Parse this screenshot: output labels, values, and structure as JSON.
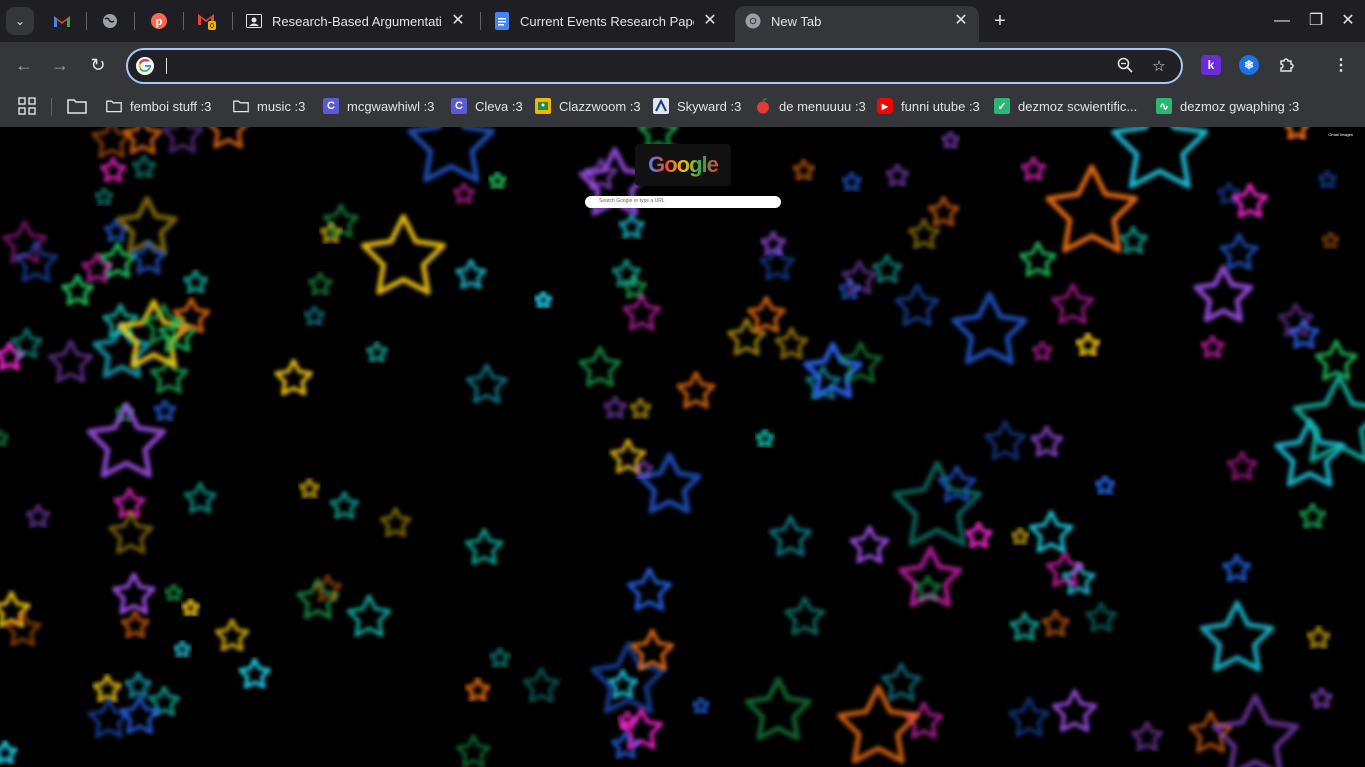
{
  "tabs": {
    "pinned": [
      {
        "name": "gmail",
        "color": "#ea4335"
      },
      {
        "name": "globe",
        "color": "#9aa0a6"
      },
      {
        "name": "p-app",
        "color": "#f96854"
      },
      {
        "name": "gmail-notify",
        "color": "#ea4335",
        "badge": "0"
      }
    ],
    "items": [
      {
        "title": "Research-Based Argumentative",
        "icon": "classroom-icon"
      },
      {
        "title": "Current Events Research Paper",
        "icon": "docs-icon"
      },
      {
        "title": "New Tab",
        "icon": "chrome-icon",
        "active": true
      }
    ]
  },
  "omnibox": {
    "value": "",
    "placeholder": ""
  },
  "bookmarks": [
    {
      "label": "femboi stuff :3",
      "icon": "folder-icon"
    },
    {
      "label": "music :3",
      "icon": "folder-icon"
    },
    {
      "label": "mcgwawhiwl :3",
      "icon": "c-icon",
      "color": "#5b5bd6",
      "glyph": "C"
    },
    {
      "label": "Cleva :3",
      "icon": "c-icon",
      "color": "#5b5bd6",
      "glyph": "C"
    },
    {
      "label": "Clazzwoom :3",
      "icon": "classroom-icon",
      "color": "#f4b400",
      "glyph": ""
    },
    {
      "label": "Skyward :3",
      "icon": "skyward-icon",
      "color": "#dfe6f2",
      "glyph": ""
    },
    {
      "label": "de menuuuu :3",
      "icon": "apple-icon",
      "color": "#e53935",
      "glyph": ""
    },
    {
      "label": "funni utube :3",
      "icon": "youtube-icon",
      "color": "#ff0000",
      "glyph": "▶"
    },
    {
      "label": "dezmoz scwientific...",
      "icon": "desmos-icon",
      "color": "#2bb673",
      "glyph": "✓"
    },
    {
      "label": "dezmoz gwaphing :3",
      "icon": "desmos-graph-icon",
      "color": "#2bb673",
      "glyph": "∿"
    }
  ],
  "ntp": {
    "logo": "Google",
    "search_placeholder": "Search Google or type a URL",
    "links": "Gmail  Images"
  },
  "extensions": [
    {
      "name": "kami",
      "glyph": "k",
      "color": "#6c2bd9"
    },
    {
      "name": "snowflake",
      "glyph": "❄",
      "color": "#1a73e8"
    }
  ]
}
